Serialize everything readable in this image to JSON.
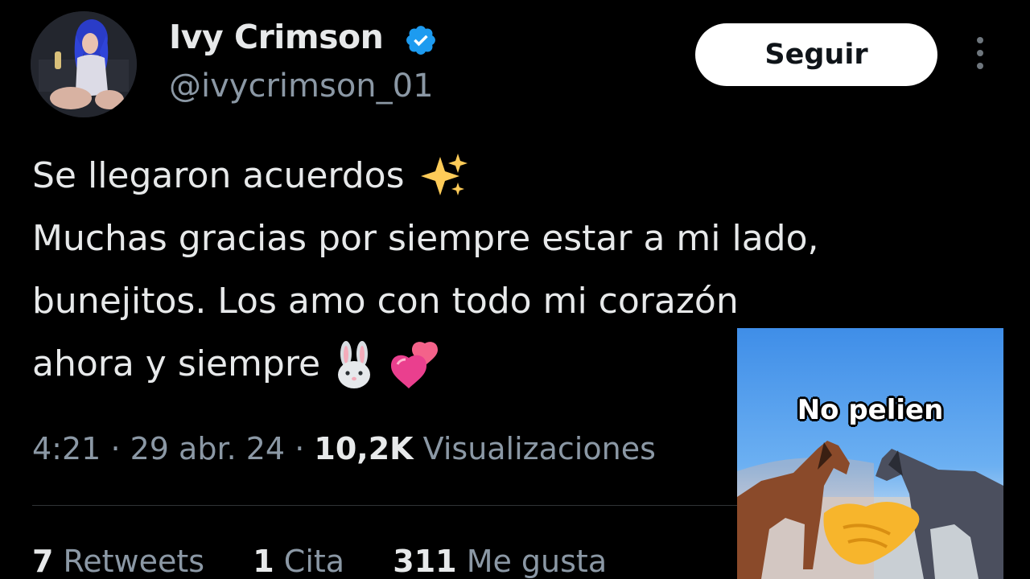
{
  "profile": {
    "display_name": "Ivy Crimson",
    "handle": "@ivycrimson_01",
    "follow_label": "Seguir"
  },
  "tweet": {
    "line1": "Se llegaron acuerdos",
    "line2": "Muchas gracias por siempre estar a mi lado,",
    "line3": "bunejitos. Los amo con todo mi corazón",
    "line4": "ahora y siempre"
  },
  "meta": {
    "time": "4:21",
    "date": "29 abr. 24",
    "views_count": "10,2K",
    "views_label": "Visualizaciones"
  },
  "stats": {
    "retweets_count": "7",
    "retweets_label": "Retweets",
    "quotes_count": "1",
    "quotes_label": "Cita",
    "likes_count": "311",
    "likes_label": "Me gusta"
  },
  "meme": {
    "caption": "No pelien"
  },
  "colors": {
    "background": "#000000",
    "verified": "#1d9bf0",
    "secondary_text": "#8b98a5"
  }
}
